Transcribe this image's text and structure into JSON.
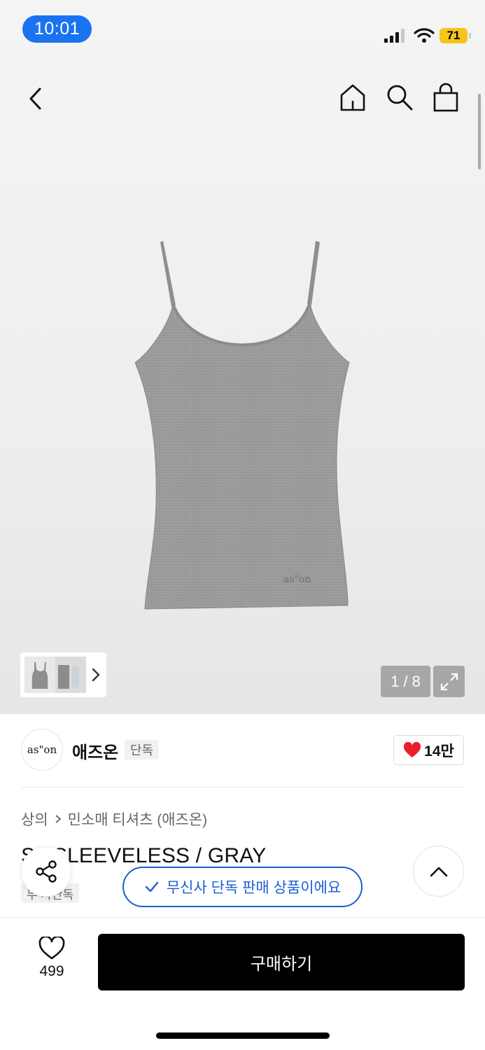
{
  "status_bar": {
    "time": "10:01",
    "battery": "71"
  },
  "gallery": {
    "counter": "1 / 8",
    "logo_print": "as\"on"
  },
  "brand": {
    "logo_text": "as\"on",
    "name": "애즈온",
    "tag": "단독",
    "likes": "14만"
  },
  "breadcrumb": {
    "category": "상의",
    "subcategory": "민소매 티셔츠 (애즈온)"
  },
  "product": {
    "name": "S   I SLEEVELESS / GRAY",
    "tag": "무  사단독"
  },
  "toast": {
    "text": "무신사 단독 판매 상품이에요"
  },
  "bottom_bar": {
    "wish_count": "499",
    "buy_label": "구매하기"
  },
  "colors": {
    "accent_blue": "#1a5fd0",
    "status_pill": "#1a73f0",
    "battery": "#f5c518",
    "heart": "#e8202a",
    "buy_button": "#000000"
  }
}
